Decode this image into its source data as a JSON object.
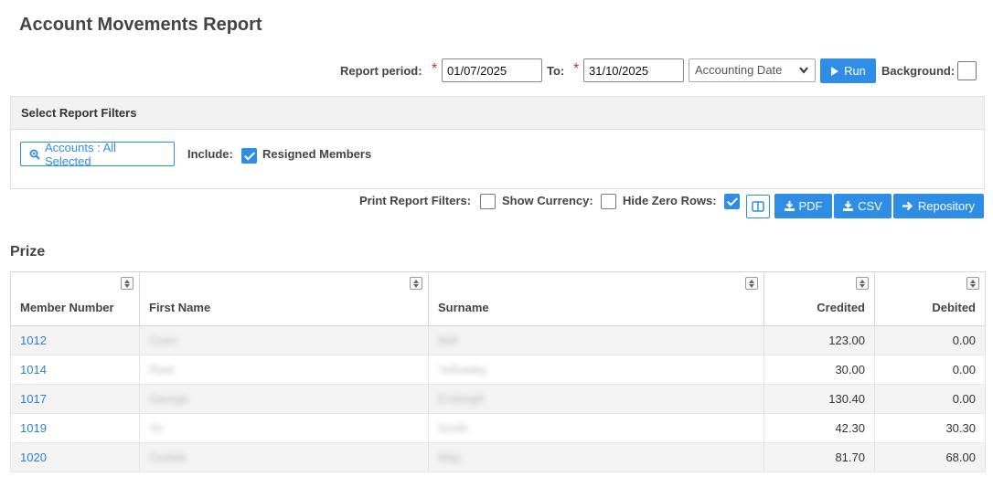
{
  "title": "Account Movements Report",
  "period": {
    "label": "Report period:",
    "required_mark": "*",
    "from_value": "01/07/2025",
    "to_label": "To:",
    "to_value": "31/10/2025",
    "date_type": "Accounting Date",
    "run_label": "Run",
    "background_label": "Background:",
    "background_checked": false
  },
  "filters": {
    "header": "Select Report Filters",
    "accounts_button": "Accounts : All Selected",
    "include_label": "Include:",
    "resigned_label": "Resigned Members",
    "resigned_checked": true
  },
  "options": {
    "print_filters_label": "Print Report Filters:",
    "print_filters_checked": false,
    "show_currency_label": "Show Currency:",
    "show_currency_checked": false,
    "hide_zero_label": "Hide Zero Rows:",
    "hide_zero_checked": true,
    "pdf_label": "PDF",
    "csv_label": "CSV",
    "repository_label": "Repository"
  },
  "section": "Prize",
  "table": {
    "columns": [
      "Member Number",
      "First Name",
      "Surname",
      "Credited",
      "Debited"
    ],
    "rows": [
      {
        "member": "1012",
        "first": "Coen",
        "surname": "Bell",
        "credited": "123.00",
        "debited": "0.00"
      },
      {
        "member": "1014",
        "first": "Reet",
        "surname": "Yellowley",
        "credited": "30.00",
        "debited": "0.00"
      },
      {
        "member": "1017",
        "first": "George",
        "surname": "Erskingh",
        "credited": "130.40",
        "debited": "0.00"
      },
      {
        "member": "1019",
        "first": "Yo",
        "surname": "Smith",
        "credited": "42.30",
        "debited": "30.30"
      },
      {
        "member": "1020",
        "first": "Cedale",
        "surname": "Way",
        "credited": "81.70",
        "debited": "68.00"
      }
    ]
  },
  "colors": {
    "accent": "#2e8ee6",
    "link": "#2e7fd1",
    "required": "#c0392b"
  }
}
